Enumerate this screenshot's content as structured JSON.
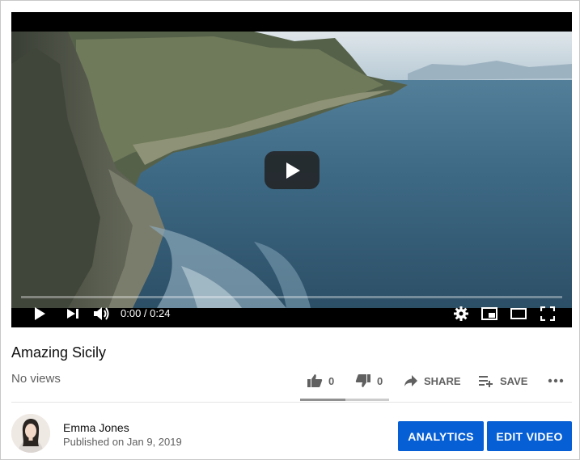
{
  "video": {
    "time_display": "0:00 / 0:24",
    "progress": 0
  },
  "info": {
    "title": "Amazing Sicily",
    "views": "No views"
  },
  "actions": {
    "likes": "0",
    "dislikes": "0",
    "share_label": "SHARE",
    "save_label": "SAVE"
  },
  "channel": {
    "name": "Emma Jones",
    "published": "Published on Jan 9, 2019"
  },
  "buttons": {
    "analytics": "ANALYTICS",
    "edit_video": "EDIT VIDEO"
  },
  "colors": {
    "accent": "#065fd4",
    "text_secondary": "#606060"
  }
}
